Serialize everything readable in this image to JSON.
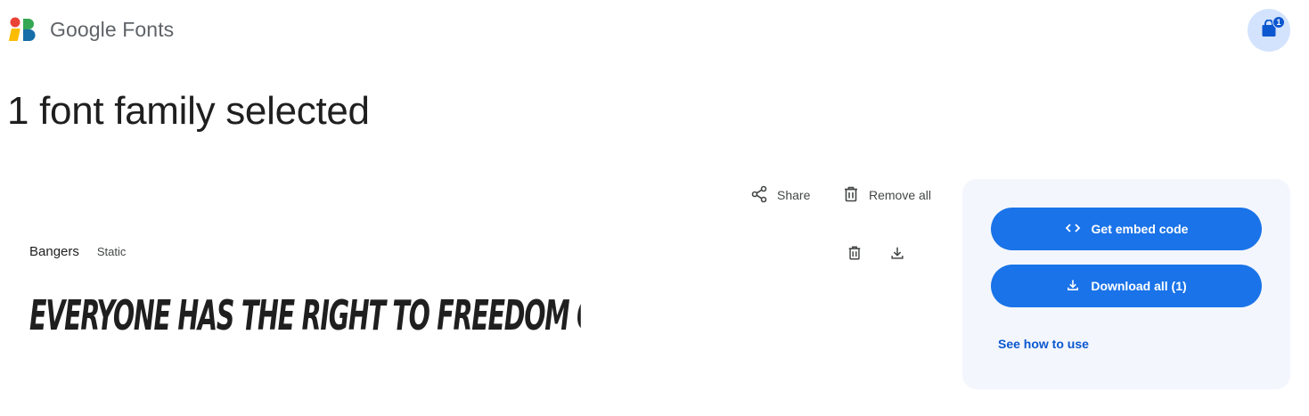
{
  "header": {
    "app_name": "Google Fonts",
    "logo_icon": "google-fonts-logo-icon",
    "cart": {
      "icon": "shopping-bag-icon",
      "count": "1"
    }
  },
  "main": {
    "title": "1 font family selected",
    "actions": {
      "share_label": "Share",
      "share_icon": "share-icon",
      "remove_all_label": "Remove all",
      "remove_all_icon": "trash-icon"
    },
    "families": [
      {
        "name": "Bangers",
        "style": "Static",
        "sample_text": "EVERYONE HAS THE RIGHT TO FREEDOM OF THOUGHT, C",
        "delete_icon": "trash-icon",
        "download_icon": "download-icon"
      }
    ]
  },
  "side_panel": {
    "embed_label": "Get embed code",
    "embed_icon": "code-icon",
    "download_label": "Download all (1)",
    "download_icon": "download-icon",
    "how_to_use_label": "See how to use"
  },
  "colors": {
    "primary_button": "#1a73e8",
    "link": "#0b57d0",
    "panel_bg": "#f3f6fc",
    "cart_bg": "#d3e3fd"
  }
}
